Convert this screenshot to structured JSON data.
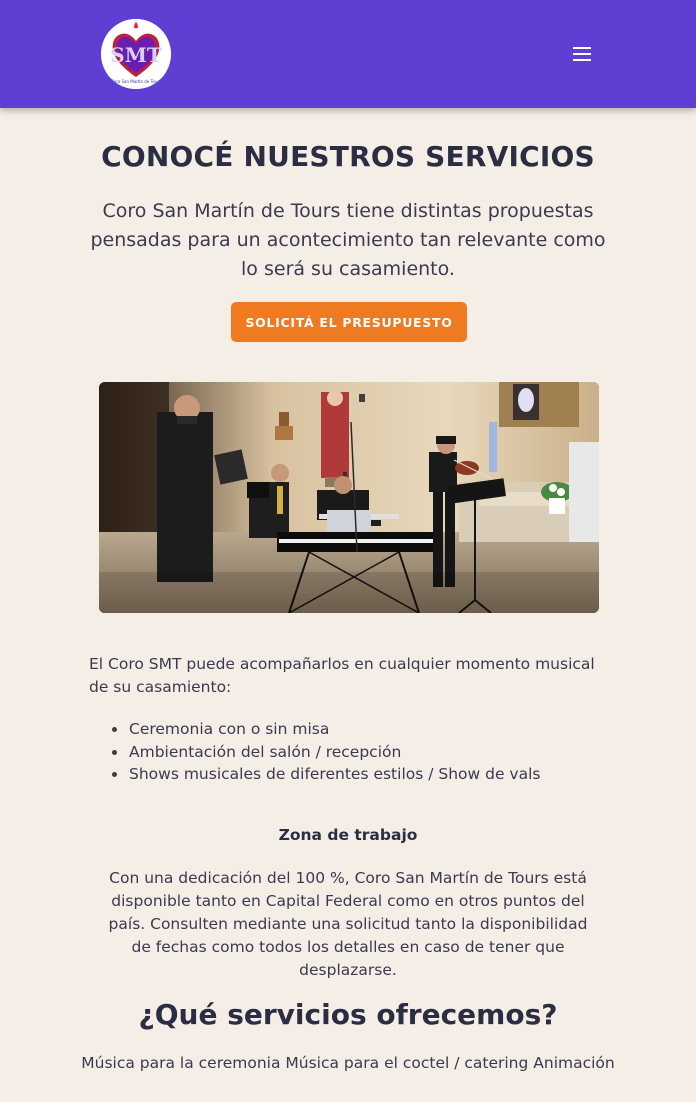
{
  "header": {
    "logo_alt": "SMT",
    "colors": {
      "background": "#5f3fd3",
      "logo_heart": "#c0203a",
      "logo_text": "#3a2fb8"
    },
    "menu_icon": "hamburger-menu-icon"
  },
  "hero": {
    "title": "CONOCÉ NUESTROS SERVICIOS",
    "intro": "Coro San Martín de Tours tiene distintas propuestas pensadas para un acontecimiento tan relevante como lo será su casamiento.",
    "cta_label": "SOLICITÁ EL PRESUPUESTO",
    "cta_color": "#f07a20"
  },
  "photo": {
    "subject": "Choir singer, trumpet player, keyboardist and violinist performing in a church"
  },
  "content": {
    "paragraph": "El Coro SMT puede acompañarlos en cualquier momento musical de su casamiento:",
    "list": [
      "Ceremonia con o sin misa",
      "Ambientación del salón / recepción",
      "Shows musicales de diferentes estilos / Show de vals"
    ],
    "zone_title": "Zona de trabajo",
    "zone_text": "Con una dedicación del 100 %, Coro San Martín de Tours está disponible tanto en Capital Federal como en otros puntos del país. Consulten mediante una solicitud tanto la disponibilidad de fechas como todos los detalles en caso de tener que desplazarse."
  },
  "services": {
    "title": "¿Qué servicios ofrecemos?",
    "text": "Música para la ceremonia Música para el coctel / catering Animación"
  }
}
